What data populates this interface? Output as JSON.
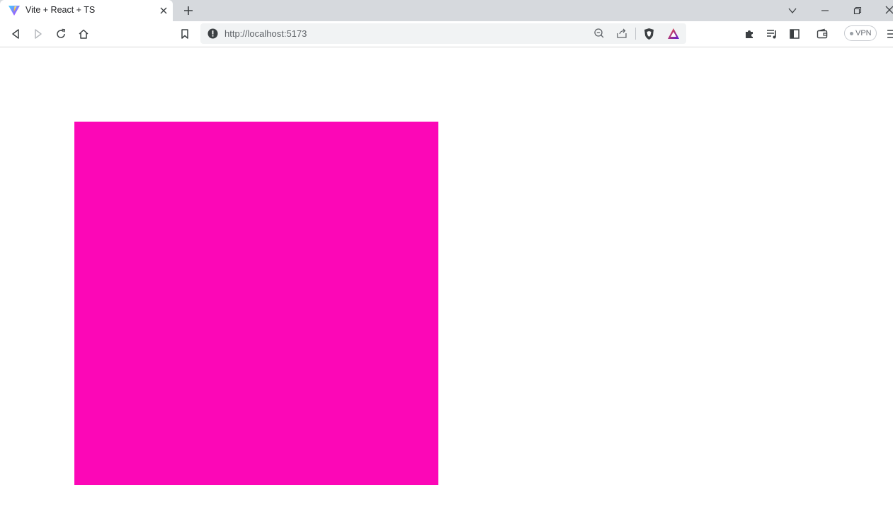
{
  "tab": {
    "title": "Vite + React + TS",
    "favicon": "vite-logo-icon"
  },
  "address_bar": {
    "url": "http://localhost:5173"
  },
  "toolbar": {
    "vpn_label": "VPN"
  },
  "icons": {
    "back": "back-arrow-icon",
    "forward": "forward-arrow-icon",
    "reload": "reload-icon",
    "home": "home-icon",
    "bookmark": "bookmark-icon",
    "info": "info-icon",
    "zoom": "zoom-out-icon",
    "share": "share-icon",
    "brave_shield": "brave-shield-icon",
    "rewards": "brave-rewards-icon",
    "extensions": "puzzle-icon",
    "playlist": "playlist-icon",
    "sidebar": "sidebar-icon",
    "wallet": "wallet-icon",
    "menu": "menu-icon"
  },
  "colors": {
    "box": "#fc07b7",
    "tabstrip": "#d6d9dd",
    "omnibox": "#f1f3f4"
  }
}
